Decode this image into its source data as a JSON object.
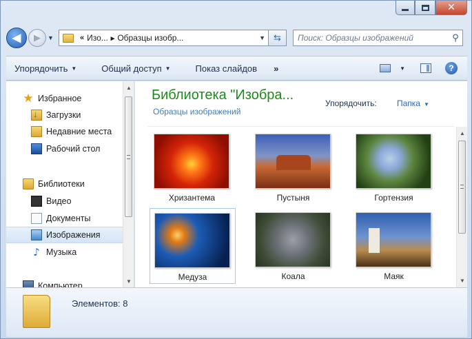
{
  "window": {
    "caption_buttons": [
      "minimize-icon",
      "maximize-icon",
      "close-icon"
    ]
  },
  "nav": {
    "back_icon": "arrow-left-icon",
    "forward_icon": "arrow-right-icon",
    "address": {
      "overflow": "«",
      "crumbs": [
        "Изо...",
        "Образцы изобр..."
      ]
    },
    "search_placeholder": "Поиск: Образцы изображений"
  },
  "toolbar": {
    "organize": "Упорядочить",
    "share": "Общий доступ",
    "slideshow": "Показ слайдов",
    "more": "»"
  },
  "sidebar": {
    "items": [
      {
        "label": "Избранное",
        "icon": "star-icon"
      },
      {
        "label": "Загрузки",
        "icon": "downloads-folder-icon"
      },
      {
        "label": "Недавние места",
        "icon": "recent-places-icon"
      },
      {
        "label": "Рабочий стол",
        "icon": "desktop-icon"
      },
      {
        "label": "Библиотеки",
        "icon": "libraries-icon"
      },
      {
        "label": "Видео",
        "icon": "video-library-icon"
      },
      {
        "label": "Документы",
        "icon": "documents-library-icon"
      },
      {
        "label": "Изображения",
        "icon": "pictures-library-icon"
      },
      {
        "label": "Музыка",
        "icon": "music-library-icon"
      },
      {
        "label": "Компьютер",
        "icon": "computer-icon"
      }
    ],
    "selected": "Изображения"
  },
  "main": {
    "title": "Библиотека \"Изобра...",
    "subtitle": "Образцы изображений",
    "arrange_label": "Упорядочить:",
    "arrange_value": "Папка",
    "files": [
      {
        "name": "Хризантема"
      },
      {
        "name": "Пустыня"
      },
      {
        "name": "Гортензия"
      },
      {
        "name": "Медуза"
      },
      {
        "name": "Коала"
      },
      {
        "name": "Маяк"
      }
    ]
  },
  "details": {
    "count_text": "Элементов: 8"
  },
  "colors": {
    "library_title": "#1e8a1e",
    "link": "#2a67bf",
    "selection": "#d5e4f6"
  }
}
